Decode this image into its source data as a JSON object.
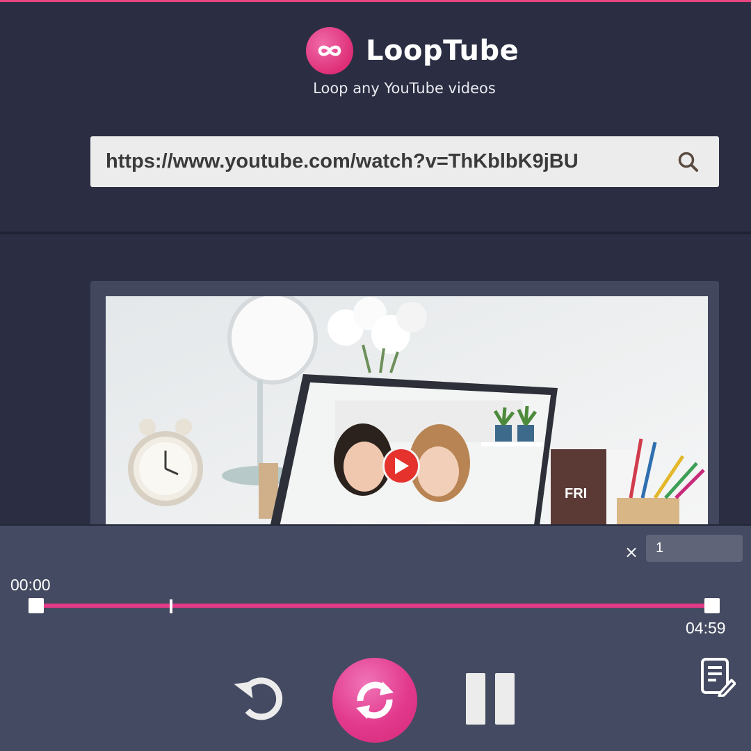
{
  "app": {
    "name": "LoopTube",
    "tagline": "Loop any YouTube videos"
  },
  "search": {
    "value": "https://www.youtube.com/watch?v=ThKblbK9jBU",
    "icon": "search-icon"
  },
  "controls": {
    "loop_multiplier_symbol": "×",
    "loop_count": "1",
    "start_time": "00:00",
    "end_time": "04:59",
    "playhead_fraction": 0.2
  },
  "colors": {
    "accent": "#e13a86",
    "background": "#2b2e42",
    "panel": "#444a61"
  }
}
